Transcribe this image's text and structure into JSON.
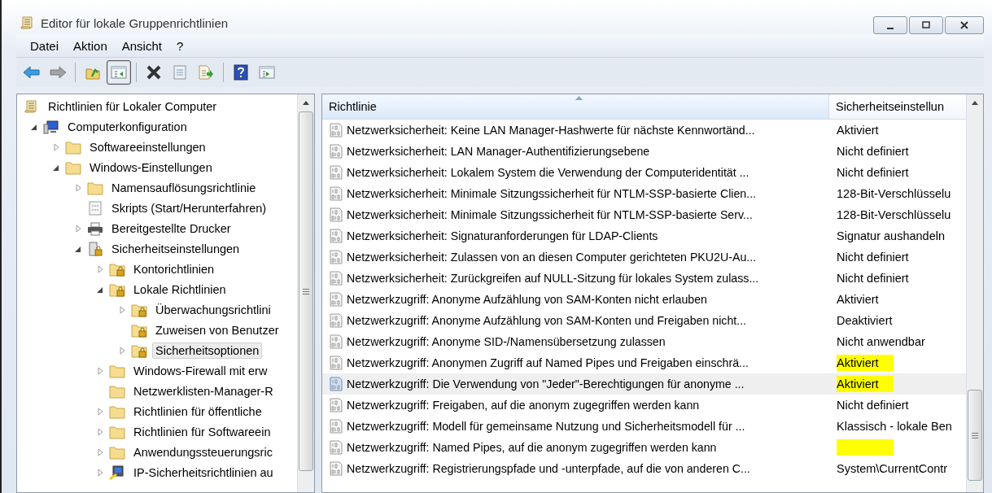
{
  "window": {
    "title": "Editor für lokale Gruppenrichtlinien"
  },
  "menu": [
    "Datei",
    "Aktion",
    "Ansicht",
    "?"
  ],
  "toolbar": [
    {
      "pressed": false,
      "disabled": false
    },
    {
      "pressed": false,
      "disabled": true
    },
    {
      "pressed": false,
      "disabled": false
    },
    {
      "pressed": true,
      "disabled": false
    },
    {
      "pressed": false,
      "disabled": false
    },
    {
      "pressed": false,
      "disabled": false
    },
    {
      "pressed": false,
      "disabled": false
    },
    {
      "pressed": false,
      "disabled": false
    },
    {
      "pressed": false,
      "disabled": false
    }
  ],
  "tree": [
    {
      "label": "Richtlinien für Lokaler Computer",
      "kind": "policy",
      "selected": false,
      "children": [
        {
          "label": "Computerkonfiguration",
          "kind": "computer",
          "expanded": true,
          "selected": false,
          "children": [
            {
              "label": "Softwareeinstellungen",
              "kind": "folder",
              "expanded": false,
              "selected": false
            },
            {
              "label": "Windows-Einstellungen",
              "kind": "folder",
              "expanded": true,
              "selected": false,
              "children": [
                {
                  "label": "Namensauflösungsrichtlinie",
                  "kind": "folder",
                  "expanded": false,
                  "selected": false
                },
                {
                  "label": "Skripts (Start/Herunterfahren)",
                  "kind": "script",
                  "selected": false
                },
                {
                  "label": "Bereitgestellte Drucker",
                  "kind": "printer",
                  "expanded": false,
                  "selected": false
                },
                {
                  "label": "Sicherheitseinstellungen",
                  "kind": "security",
                  "expanded": true,
                  "selected": false,
                  "children": [
                    {
                      "label": "Kontorichtlinien",
                      "kind": "lockfolder",
                      "expanded": false,
                      "selected": false
                    },
                    {
                      "label": "Lokale Richtlinien",
                      "kind": "lockfolder",
                      "expanded": true,
                      "selected": false,
                      "children": [
                        {
                          "label": "Überwachungsrichtlini",
                          "kind": "lockfolder",
                          "expanded": false,
                          "selected": false
                        },
                        {
                          "label": "Zuweisen von Benutzer",
                          "kind": "lockfolder",
                          "selected": false
                        },
                        {
                          "label": "Sicherheitsoptionen",
                          "kind": "lockfolder",
                          "expanded": false,
                          "selected": true
                        }
                      ]
                    },
                    {
                      "label": "Windows-Firewall mit erw",
                      "kind": "folder",
                      "expanded": false,
                      "selected": false
                    },
                    {
                      "label": "Netzwerklisten-Manager-R",
                      "kind": "folder",
                      "selected": false
                    },
                    {
                      "label": "Richtlinien für öffentliche",
                      "kind": "folder",
                      "expanded": false,
                      "selected": false
                    },
                    {
                      "label": "Richtlinien für Softwareein",
                      "kind": "folder",
                      "expanded": false,
                      "selected": false
                    },
                    {
                      "label": "Anwendungssteuerungsric",
                      "kind": "folder",
                      "expanded": false,
                      "selected": false
                    },
                    {
                      "label": "IP-Sicherheitsrichtlinien au",
                      "kind": "network",
                      "expanded": false,
                      "selected": false
                    }
                  ]
                }
              ]
            }
          ]
        }
      ]
    }
  ],
  "list": {
    "columns": [
      {
        "label": "Richtlinie",
        "sorted": true
      },
      {
        "label": "Sicherheitseinstellun",
        "sorted": false
      }
    ],
    "rows": [
      {
        "policy": "Netzwerksicherheit: Keine LAN Manager-Hashwerte für nächste Kennwortänd...",
        "setting": "Aktiviert",
        "highlighted": false,
        "selected": false
      },
      {
        "policy": "Netzwerksicherheit: LAN Manager-Authentifizierungsebene",
        "setting": "Nicht definiert",
        "highlighted": false,
        "selected": false
      },
      {
        "policy": "Netzwerksicherheit: Lokalem System die Verwendung der Computeridentität ...",
        "setting": "Nicht definiert",
        "highlighted": false,
        "selected": false
      },
      {
        "policy": "Netzwerksicherheit: Minimale Sitzungssicherheit für NTLM-SSP-basierte Clien...",
        "setting": "128-Bit-Verschlüsselu",
        "highlighted": false,
        "selected": false
      },
      {
        "policy": "Netzwerksicherheit: Minimale Sitzungssicherheit für NTLM-SSP-basierte Serv...",
        "setting": "128-Bit-Verschlüsselu",
        "highlighted": false,
        "selected": false
      },
      {
        "policy": "Netzwerksicherheit: Signaturanforderungen für LDAP-Clients",
        "setting": "Signatur aushandeln",
        "highlighted": false,
        "selected": false
      },
      {
        "policy": "Netzwerksicherheit: Zulassen von an diesen Computer gerichteten PKU2U-Au...",
        "setting": "Nicht definiert",
        "highlighted": false,
        "selected": false
      },
      {
        "policy": "Netzwerksicherheit: Zurückgreifen auf NULL-Sitzung für lokales System zulass...",
        "setting": "Nicht definiert",
        "highlighted": false,
        "selected": false
      },
      {
        "policy": "Netzwerkzugriff: Anonyme Aufzählung von SAM-Konten nicht erlauben",
        "setting": "Aktiviert",
        "highlighted": false,
        "selected": false
      },
      {
        "policy": "Netzwerkzugriff: Anonyme Aufzählung von SAM-Konten und Freigaben nicht...",
        "setting": "Deaktiviert",
        "highlighted": false,
        "selected": false
      },
      {
        "policy": "Netzwerkzugriff: Anonyme SID-/Namensübersetzung zulassen",
        "setting": "Nicht anwendbar",
        "highlighted": false,
        "selected": false
      },
      {
        "policy": "Netzwerkzugriff: Anonymen Zugriff auf Named Pipes und Freigaben einschrä...",
        "setting": "Aktiviert",
        "highlighted": true,
        "selected": false
      },
      {
        "policy": "Netzwerkzugriff: Die Verwendung von \"Jeder\"-Berechtigungen für anonyme ...",
        "setting": "Aktiviert",
        "highlighted": true,
        "selected": true
      },
      {
        "policy": "Netzwerkzugriff: Freigaben, auf die anonym zugegriffen werden kann",
        "setting": "Nicht definiert",
        "highlighted": false,
        "selected": false
      },
      {
        "policy": "Netzwerkzugriff: Modell für gemeinsame Nutzung und Sicherheitsmodell für ...",
        "setting": "Klassisch - lokale Ben",
        "highlighted": false,
        "selected": false
      },
      {
        "policy": "Netzwerkzugriff: Named Pipes, auf die anonym zugegriffen werden kann",
        "highlighted": true,
        "selected": false
      },
      {
        "policy": "Netzwerkzugriff: Registrierungspfade und -unterpfade, auf die von anderen C...",
        "setting": "System\\CurrentContr",
        "highlighted": false,
        "selected": false
      }
    ]
  }
}
